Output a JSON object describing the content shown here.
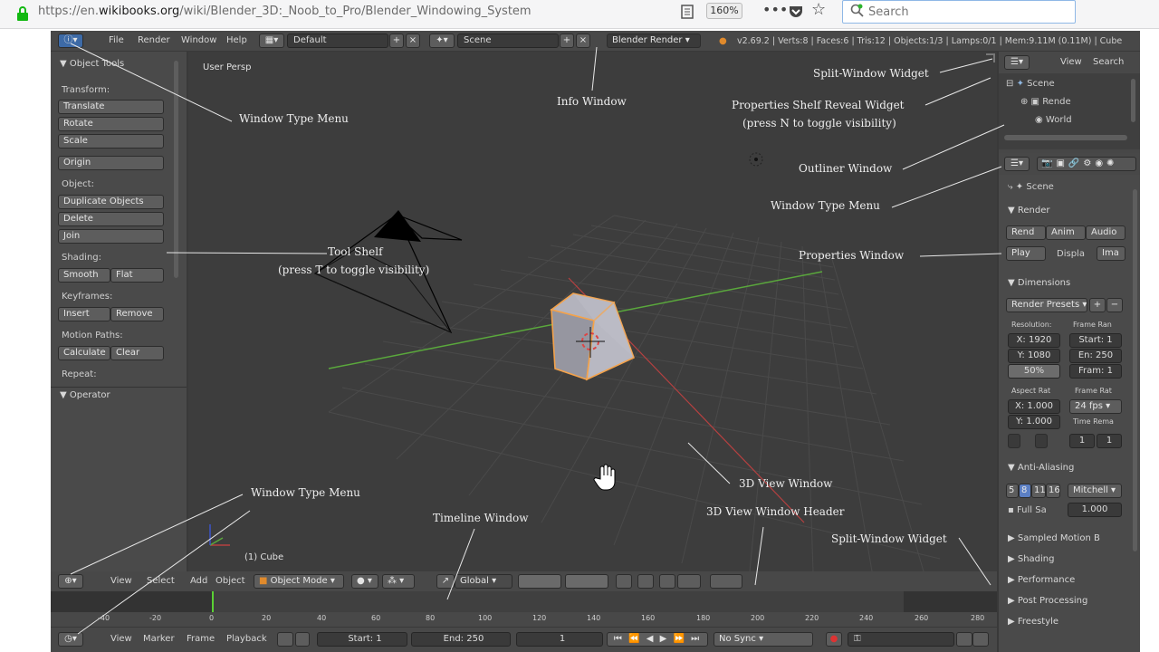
{
  "browser": {
    "url_prefix": "https://en.",
    "url_domain": "wikibooks.org",
    "url_path": "/wiki/Blender_3D:_Noob_to_Pro/Blender_Windowing_System",
    "zoom": "160%",
    "more": "•••",
    "star": "☆",
    "search_placeholder": "Search"
  },
  "top_header": {
    "menus": [
      "File",
      "Render",
      "Window",
      "Help"
    ],
    "layout": "Default",
    "scene": "Scene",
    "engine": "Blender Render",
    "stats": "v2.69.2 | Verts:8 | Faces:6 | Tris:12 | Objects:1/3 | Lamps:0/1 | Mem:9.11M (0.11M) | Cube"
  },
  "toolshelf": {
    "title": "▼ Object Tools",
    "transform_label": "Transform:",
    "translate": "Translate",
    "rotate": "Rotate",
    "scale": "Scale",
    "origin": "Origin",
    "object_label": "Object:",
    "duplicate": "Duplicate Objects",
    "delete": "Delete",
    "join": "Join",
    "shading_label": "Shading:",
    "smooth": "Smooth",
    "flat": "Flat",
    "keyframes_label": "Keyframes:",
    "insert": "Insert",
    "remove": "Remove",
    "motion_label": "Motion Paths:",
    "calculate": "Calculate",
    "clear": "Clear",
    "repeat_label": "Repeat:",
    "operator": "▼ Operator"
  },
  "viewport": {
    "view_name": "User Persp",
    "object_name": "(1) Cube"
  },
  "view_header": {
    "menus": [
      "View",
      "Select",
      "Add",
      "Object"
    ],
    "mode": "Object Mode",
    "orientation": "Global"
  },
  "timeline": {
    "ticks": [
      "-40",
      "-20",
      "0",
      "20",
      "40",
      "60",
      "80",
      "100",
      "120",
      "140",
      "160",
      "180",
      "200",
      "220",
      "240",
      "260",
      "280"
    ],
    "menus": [
      "View",
      "Marker",
      "Frame",
      "Playback"
    ],
    "start": "Start: 1",
    "end": "End: 250",
    "current": "1",
    "sync": "No Sync"
  },
  "outliner": {
    "view": "View",
    "search": "Search",
    "items": [
      "Scene",
      "Rende",
      "World"
    ]
  },
  "properties": {
    "scene": "Scene",
    "render_section": "▼ Render",
    "render_btn": "Rend",
    "anim_btn": "Anim",
    "audio_btn": "Audio",
    "display_label": "Displa",
    "play_btn": "Play",
    "image_btn": "Ima",
    "dimensions_section": "▼ Dimensions",
    "presets": "Render Presets",
    "resolution_label": "Resolution:",
    "frame_range_label": "Frame Ran",
    "res_x": "X: 1920",
    "res_y": "Y: 1080",
    "res_pct": "50%",
    "start": "Start: 1",
    "end": "En: 250",
    "step": "Fram: 1",
    "aspect_label": "Aspect Rat",
    "frame_rate_label": "Frame Rat",
    "aspect_x": "X: 1.000",
    "aspect_y": "Y: 1.000",
    "fps": "24 fps",
    "time_remap_label": "Time Rema",
    "remap_old": "1",
    "remap_new": "1",
    "aa_section": "▼ Anti-Aliasing",
    "aa_samples": [
      "5",
      "8",
      "11",
      "16"
    ],
    "aa_filter": "Mitchell",
    "full_sample": "Full Sa",
    "filter_size": "1.000",
    "sampled_motion": "▶ Sampled Motion B",
    "shading": "▶ Shading",
    "performance": "▶ Performance",
    "post_processing": "▶ Post Processing",
    "freestyle": "▶ Freestyle"
  },
  "annotations": {
    "window_type_menu_top": "Window Type Menu",
    "info_window": "Info Window",
    "split_widget_top": "Split-Window Widget",
    "properties_shelf_1": "Properties Shelf Reveal Widget",
    "properties_shelf_2": "(press N to toggle visibility)",
    "outliner_window": "Outliner Window",
    "window_type_menu_right": "Window Type Menu",
    "tool_shelf_1": "Tool Shelf",
    "tool_shelf_2": "(press T to toggle visibility)",
    "properties_window": "Properties Window",
    "view3d_window": "3D View Window",
    "window_type_menu_bottom": "Window Type Menu",
    "timeline_window": "Timeline Window",
    "view3d_header": "3D View Window Header",
    "split_widget_bottom": "Split-Window Widget"
  },
  "colors": {
    "selection_orange": "#f4a24a",
    "x_axis": "#b64040",
    "y_axis": "#5aa83c",
    "timeline_cursor": "#5ad034"
  }
}
